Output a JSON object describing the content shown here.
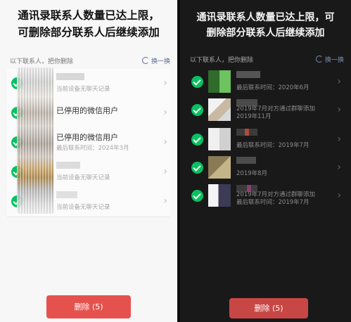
{
  "light_panel": {
    "title_line1": "通讯录联系人数量已达上限，",
    "title_line2": "可删除部分联系人后继续添加",
    "list_hint": "以下联系人，把你删除",
    "refresh_label": "换一换",
    "contacts": [
      {
        "name": "",
        "sub": "当前设备无聊天记录"
      },
      {
        "name": "已停用的微信用户",
        "sub": ""
      },
      {
        "name": "已停用的微信用户",
        "sub": "最后联系时间：2024年3月"
      },
      {
        "name": "",
        "sub": "当前设备无聊天记录"
      },
      {
        "name": "",
        "sub": "当前设备无聊天记录"
      }
    ],
    "delete_button": "删除 (5)"
  },
  "dark_panel": {
    "title_line1": "通讯录联系人数量已达上限，可",
    "title_line2": "删除部分联系人后继续添加",
    "list_hint": "以下联系人，把你删除",
    "refresh_label": "换一换",
    "contacts": [
      {
        "name": "",
        "sub": "最后联系时间：2020年6月"
      },
      {
        "name": "",
        "sub": "2019年7月对方通过群聊添加\n2019年11月"
      },
      {
        "name": "",
        "sub": "最后联系时间：2019年7月"
      },
      {
        "name": "",
        "sub": "2019年8月"
      },
      {
        "name": "",
        "sub": "2019年7月对方通过群聊添加\n最后联系时间：2019年7月"
      }
    ],
    "delete_button": "删除 (5)"
  },
  "colors": {
    "check_green": "#07c160",
    "delete_red": "#e5524e",
    "link_blue": "#576b95"
  },
  "icons": [
    "check-circle-icon",
    "chevron-right-icon",
    "refresh-icon"
  ]
}
